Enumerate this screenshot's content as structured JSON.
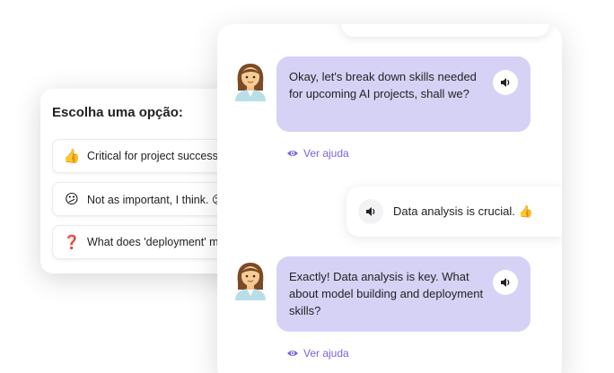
{
  "options": {
    "title": "Escolha uma opção:",
    "items": [
      {
        "emoji": "👍",
        "label": "Critical for project success",
        "icon": "thumbs-up-icon"
      },
      {
        "emoji": "😕",
        "label": "Not as important, I think. 😕",
        "icon": "confused-face-icon"
      },
      {
        "emoji": "❓",
        "label": "What does 'deployment' mean?",
        "icon": "question-mark-icon"
      }
    ]
  },
  "chat": {
    "messages": [
      {
        "role": "bot",
        "text": "Okay, let's break down skills needed for upcoming AI projects, shall we?",
        "help": "Ver ajuda"
      },
      {
        "role": "user",
        "text": "Data analysis is crucial. 👍"
      },
      {
        "role": "bot",
        "text": "Exactly! Data analysis is key. What about model building and deployment skills?",
        "help": "Ver ajuda"
      }
    ]
  },
  "colors": {
    "bot_bubble": "#d6d2f6",
    "accent": "#7a63e0",
    "text": "#222222"
  }
}
